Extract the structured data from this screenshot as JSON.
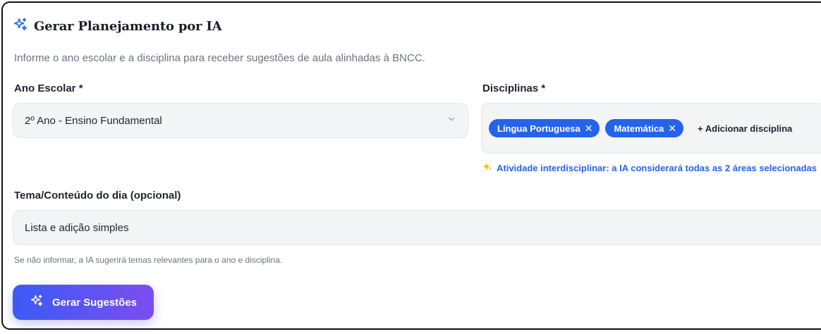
{
  "header": {
    "title": "Gerar Planejamento por IA",
    "subtitle": "Informe o ano escolar e a disciplina para receber sugestões de aula alinhadas à BNCC."
  },
  "ano_escolar": {
    "label": "Ano Escolar *",
    "selected": "2º Ano - Ensino Fundamental"
  },
  "disciplinas": {
    "label": "Disciplinas *",
    "chips": [
      {
        "label": "Língua Portuguesa"
      },
      {
        "label": "Matemática"
      }
    ],
    "add_label": "+ Adicionar disciplina",
    "interdisciplinary_note": "Atividade interdisciplinar: a IA considerará todas as 2 áreas selecionadas"
  },
  "tema": {
    "label": "Tema/Conteúdo do dia (opcional)",
    "value": "Lista e adição simples",
    "hint": "Se não informar, a IA sugerirá temas relevantes para o ano e disciplina."
  },
  "actions": {
    "generate_label": "Gerar Sugestões"
  },
  "colors": {
    "accent": "#2563eb",
    "button_gradient_start": "#3b5bf6",
    "button_gradient_end": "#7c4df0"
  }
}
